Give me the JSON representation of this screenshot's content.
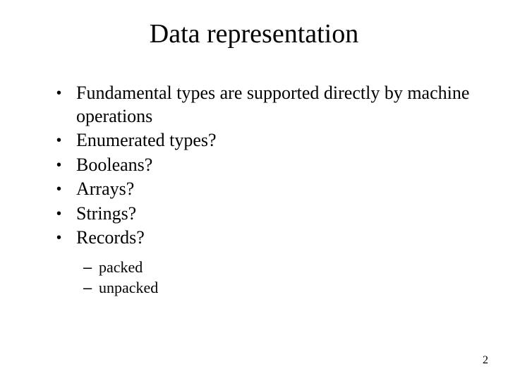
{
  "title": "Data representation",
  "bullets": {
    "b0": "Fundamental types are supported directly by machine operations",
    "b1": "Enumerated types?",
    "b2": "Booleans?",
    "b3": "Arrays?",
    "b4": "Strings?",
    "b5": "Records?"
  },
  "sub": {
    "s0": "packed",
    "s1": "unpacked"
  },
  "page": "2"
}
